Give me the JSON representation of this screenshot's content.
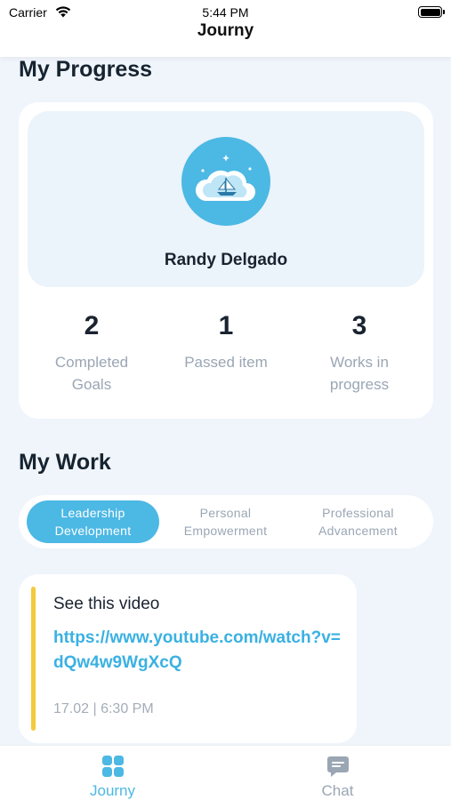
{
  "status_bar": {
    "carrier": "Carrier",
    "time": "5:44 PM"
  },
  "nav": {
    "title": "Journy"
  },
  "progress": {
    "section_title": "My Progress",
    "profile_name": "Randy Delgado",
    "stats": [
      {
        "value": "2",
        "label": "Completed Goals"
      },
      {
        "value": "1",
        "label": "Passed item"
      },
      {
        "value": "3",
        "label": "Works in progress"
      }
    ]
  },
  "work": {
    "section_title": "My Work",
    "tabs": [
      {
        "label": "Leadership Development",
        "active": true
      },
      {
        "label": "Personal Empowerment",
        "active": false
      },
      {
        "label": "Professional Advancement",
        "active": false
      }
    ],
    "card": {
      "title": "See this video",
      "link": "https://www.youtube.com/watch?v=dQw4w9WgXcQ",
      "timestamp": "17.02 | 6:30 PM"
    }
  },
  "tabbar": {
    "items": [
      {
        "label": "Journy",
        "icon": "grid-icon",
        "active": true
      },
      {
        "label": "Chat",
        "icon": "chat-icon",
        "active": false
      }
    ]
  },
  "colors": {
    "accent": "#4cb8e4",
    "link": "#3ab1e2",
    "highlight_bar": "#f4c93c",
    "background": "#f0f5fc",
    "muted_text": "#9aa6b4"
  }
}
